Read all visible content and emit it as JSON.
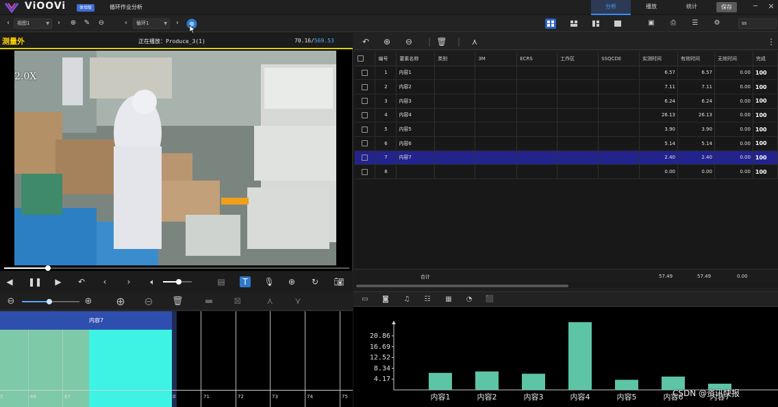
{
  "titlebar": {
    "logo": "ViOOVi",
    "edition": "体验版",
    "app_title": "循环作业分析",
    "tabs": [
      "分析",
      "播放",
      "统计"
    ],
    "save_label": "保存",
    "minimize_glyph": "─",
    "close_glyph": "✕"
  },
  "toolbar": {
    "view_select": "视图1",
    "cycle_select": "循环1",
    "view_combo": "ss",
    "icons": [
      "chevron-left-icon",
      "chevron-right-icon",
      "add-icon",
      "edit-icon",
      "remove-icon",
      "chevron-left-icon",
      "chevron-right-icon",
      "record-icon",
      "layout-grid-icon",
      "layout-2x2-icon",
      "layout-split-icon",
      "layout-single-icon",
      "video-icon",
      "print-icon",
      "list-icon",
      "settings-icon"
    ]
  },
  "video": {
    "measure_label": "测量外",
    "now_playing": "正在播放：Produce_3(1)",
    "time_current": "70.16/",
    "time_total": "569.53",
    "speed": "2.0X",
    "progress": 0.127,
    "volume": 0.55,
    "colors": {
      "measure": "#ffd400",
      "accent": "#3a8cff"
    }
  },
  "timeline": {
    "zoom": 0.48,
    "current_label": "内容7",
    "left_ticks": [
      "5",
      "66",
      "67"
    ],
    "right_ticks": [
      "0",
      "71",
      "72",
      "73",
      "74",
      "75"
    ]
  },
  "table": {
    "columns": [
      "编号",
      "要素名称",
      "类别",
      "3M",
      "ECRS",
      "工作区",
      "SSQCDE",
      "实测时间",
      "有效时间",
      "无效时间",
      "完成"
    ],
    "rows": [
      {
        "no": "1",
        "name": "内容1",
        "measured": "6.57",
        "effective": "6.57",
        "invalid": "0.00",
        "pct": "100"
      },
      {
        "no": "2",
        "name": "内容2",
        "measured": "7.11",
        "effective": "7.11",
        "invalid": "0.00",
        "pct": "100"
      },
      {
        "no": "3",
        "name": "内容3",
        "measured": "6.24",
        "effective": "6.24",
        "invalid": "0.00",
        "pct": "100"
      },
      {
        "no": "4",
        "name": "内容4",
        "measured": "26.13",
        "effective": "26.13",
        "invalid": "0.00",
        "pct": "100"
      },
      {
        "no": "5",
        "name": "内容5",
        "measured": "3.90",
        "effective": "3.90",
        "invalid": "0.00",
        "pct": "100"
      },
      {
        "no": "6",
        "name": "内容6",
        "measured": "5.14",
        "effective": "5.14",
        "invalid": "0.00",
        "pct": "100"
      },
      {
        "no": "7",
        "name": "内容7",
        "measured": "2.40",
        "effective": "2.40",
        "invalid": "0.00",
        "pct": "100"
      },
      {
        "no": "8",
        "name": "",
        "measured": "0.00",
        "effective": "0.00",
        "invalid": "0.00",
        "pct": "100"
      }
    ],
    "selected_row": 7,
    "total_label": "合计",
    "total_measured": "57.49",
    "total_effective": "57.49",
    "total_invalid": "0.00"
  },
  "chart_data": {
    "type": "bar",
    "categories": [
      "内容1",
      "内容2",
      "内容3",
      "内容4",
      "内容5",
      "内容6",
      "内容7"
    ],
    "values": [
      6.57,
      7.11,
      6.24,
      26.13,
      3.9,
      5.14,
      2.4
    ],
    "yticks": [
      "4.17",
      "8.34",
      "12.52",
      "16.69",
      "20.86"
    ],
    "title": "",
    "xlabel": "",
    "ylabel": "",
    "ylim": [
      0,
      26.13
    ],
    "grid": false,
    "color": "#5ec4a6"
  },
  "watermark": "CSDN @资讯快报"
}
